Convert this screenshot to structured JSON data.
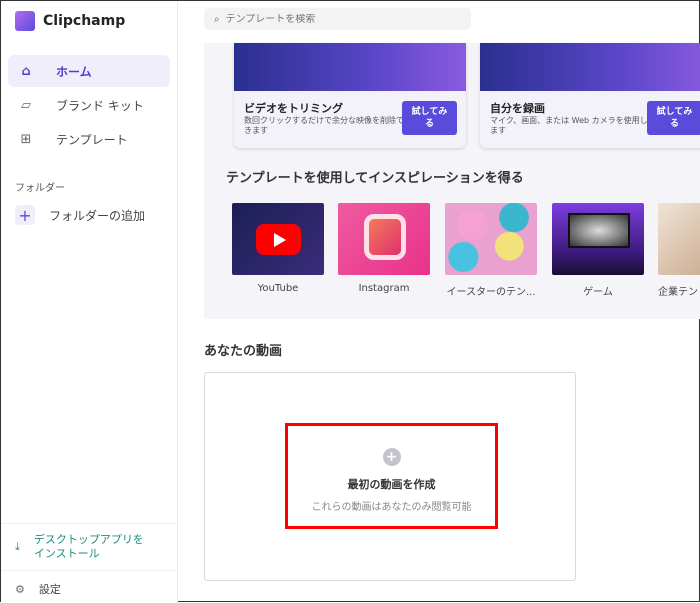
{
  "app": {
    "name": "Clipchamp"
  },
  "sidebar": {
    "items": [
      {
        "label": "ホーム",
        "icon": "home-icon"
      },
      {
        "label": "ブランド キット",
        "icon": "brand-kit-icon"
      },
      {
        "label": "テンプレート",
        "icon": "template-icon"
      }
    ],
    "folders_label": "フォルダー",
    "add_folder": "フォルダーの追加",
    "install": "デスクトップアプリを\nインストール",
    "settings": "設定"
  },
  "search": {
    "placeholder": "テンプレートを検索"
  },
  "cards": [
    {
      "title": "ビデオをトリミング",
      "desc": "数回クリックするだけで余分な映像を削除できます",
      "button": "試してみる"
    },
    {
      "title": "自分を録画",
      "desc": "マイク、画面、または Web カメラを使用します",
      "button": "試してみる"
    }
  ],
  "templates": {
    "heading": "テンプレートを使用してインスピレーションを得る",
    "items": [
      "YouTube",
      "Instagram",
      "イースターのテン...",
      "ゲーム",
      "企業テン"
    ]
  },
  "videos": {
    "heading": "あなたの動画",
    "create_title": "最初の動画を作成",
    "create_sub": "これらの動画はあなたのみ閲覧可能"
  },
  "colors": {
    "accent": "#5b4bdb",
    "highlight": "#ff0000",
    "install": "#1f8a7a"
  }
}
